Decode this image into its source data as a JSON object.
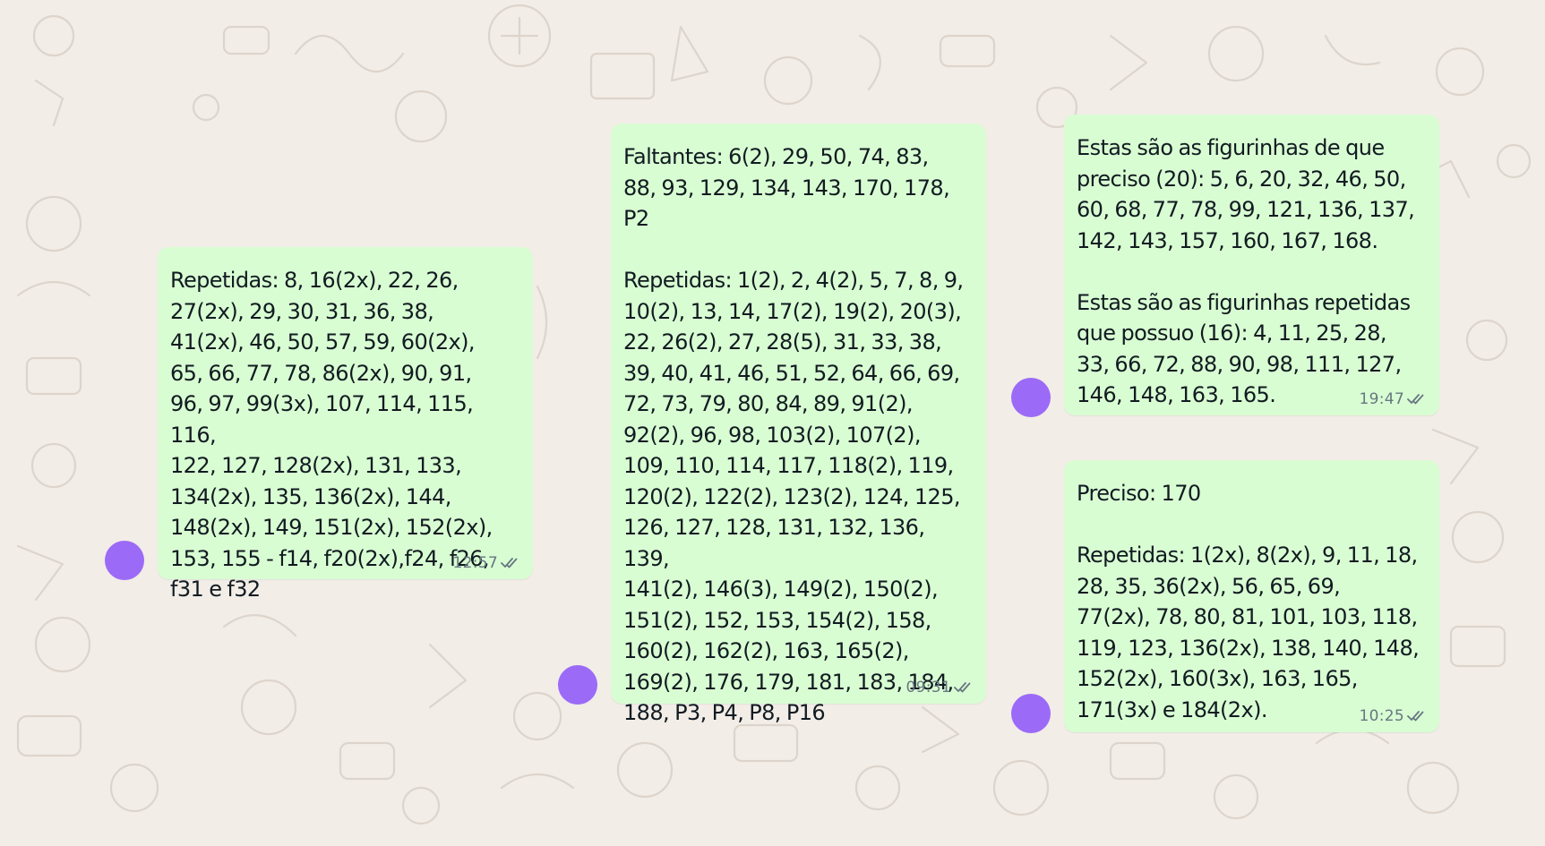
{
  "chat": {
    "messages": [
      {
        "text": "Repetidas: 8, 16(2x), 22, 26,\n27(2x), 29, 30, 31, 36, 38,\n41(2x), 46, 50, 57, 59, 60(2x),\n65, 66, 77, 78, 86(2x), 90, 91,\n96, 97, 99(3x), 107, 114, 115, 116,\n122, 127, 128(2x), 131, 133,\n134(2x), 135, 136(2x), 144,\n148(2x), 149, 151(2x), 152(2x),\n153, 155 - f14, f20(2x),f24, f26,\nf31 e f32",
        "time": "12:57",
        "status_icon": "double-check-icon"
      },
      {
        "text": "Faltantes: 6(2), 29, 50, 74, 83,\n88, 93, 129, 134, 143, 170, 178,\nP2\n\nRepetidas: 1(2), 2, 4(2), 5, 7, 8, 9,\n10(2), 13, 14, 17(2), 19(2), 20(3),\n22, 26(2), 27, 28(5), 31, 33, 38,\n39, 40, 41, 46, 51, 52, 64, 66, 69,\n72, 73, 79, 80, 84, 89, 91(2),\n92(2), 96, 98, 103(2), 107(2),\n109, 110, 114, 117, 118(2), 119,\n120(2), 122(2), 123(2), 124, 125,\n126, 127, 128, 131, 132, 136, 139,\n141(2), 146(3), 149(2), 150(2),\n151(2), 152, 153, 154(2), 158,\n160(2), 162(2), 163, 165(2),\n169(2), 176, 179, 181, 183, 184,\n188, P3, P4, P8, P16",
        "time": "09:31",
        "status_icon": "double-check-icon"
      },
      {
        "text": "Estas são as figurinhas de que\npreciso (20): 5, 6, 20, 32, 46, 50,\n60, 68, 77, 78, 99, 121, 136, 137,\n142, 143, 157, 160, 167, 168.\n\nEstas são as figurinhas repetidas\nque possuo (16): 4, 11, 25, 28,\n33, 66, 72, 88, 90, 98, 111, 127,\n146, 148, 163, 165.",
        "time": "19:47",
        "status_icon": "double-check-icon"
      },
      {
        "text": "Preciso: 170\n\nRepetidas: 1(2x), 8(2x), 9, 11, 18,\n28, 35, 36(2x), 56, 65, 69,\n77(2x), 78, 80, 81, 101, 103, 118,\n119, 123, 136(2x), 138, 140, 148,\n152(2x), 160(3x), 163, 165,\n171(3x) e 184(2x).",
        "time": "10:25",
        "status_icon": "double-check-icon"
      }
    ]
  },
  "colors": {
    "background": "#f2ede7",
    "bubble": "#d9fdd3",
    "avatar": "#9b6bf7",
    "text": "#111b21",
    "meta": "#667781"
  }
}
